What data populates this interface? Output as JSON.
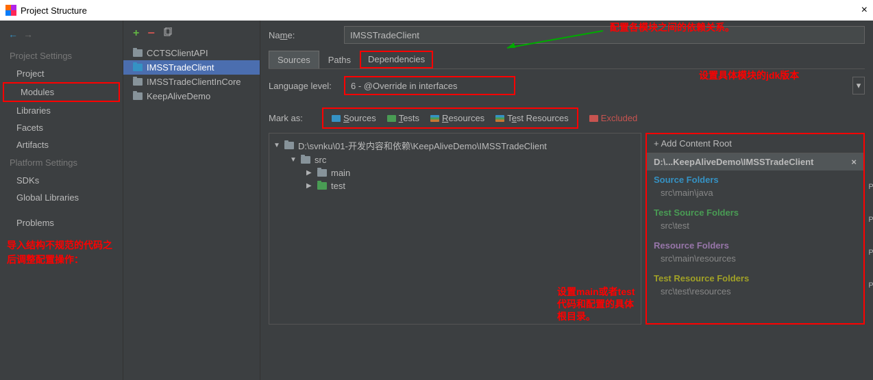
{
  "window": {
    "title": "Project Structure",
    "close": "×"
  },
  "nav": {
    "project_settings": "Project Settings",
    "items1": {
      "project": "Project",
      "modules": "Modules",
      "libraries": "Libraries",
      "facets": "Facets",
      "artifacts": "Artifacts"
    },
    "platform_settings": "Platform Settings",
    "items2": {
      "sdks": "SDKs",
      "global_libs": "Global Libraries"
    },
    "problems": "Problems"
  },
  "annotations": {
    "left": "导入结构不规范的代码之后调整配置操作：",
    "top": "配置各模块之间的依赖关系。",
    "jdk": "设置具体模块的jdk版本",
    "tree": "设置main或者test代码和配置的具体根目录。"
  },
  "modules": {
    "m1": "CCTSClientAPI",
    "m2": "IMSSTradeClient",
    "m3": "IMSSTradeClientInCore",
    "m4": "KeepAliveDemo"
  },
  "form": {
    "name_label": "Name:",
    "name_value": "IMSSTradeClient",
    "tabs": {
      "sources": "Sources",
      "paths": "Paths",
      "deps": "Dependencies"
    },
    "lang_label": "Language level:",
    "lang_value": "6 - @Override in interfaces",
    "mark_label": "Mark as:",
    "marks": {
      "sources": "Sources",
      "tests": "Tests",
      "resources": "Resources",
      "test_resources": "Test Resources",
      "excluded": "Excluded"
    }
  },
  "tree": {
    "root": "D:\\svnku\\01-开发内容和依赖\\KeepAliveDemo\\IMSSTradeClient",
    "src": "src",
    "main": "main",
    "test": "test"
  },
  "right": {
    "add": "Add Content Root",
    "path": "D:\\...KeepAliveDemo\\IMSSTradeClient",
    "source_folders": "Source Folders",
    "source_path": "src\\main\\java",
    "test_folders": "Test Source Folders",
    "test_path": "src\\test",
    "resource_folders": "Resource Folders",
    "resource_path": "src\\main\\resources",
    "tresource_folders": "Test Resource Folders",
    "tresource_path": "src\\test\\resources",
    "px": "P ×"
  }
}
